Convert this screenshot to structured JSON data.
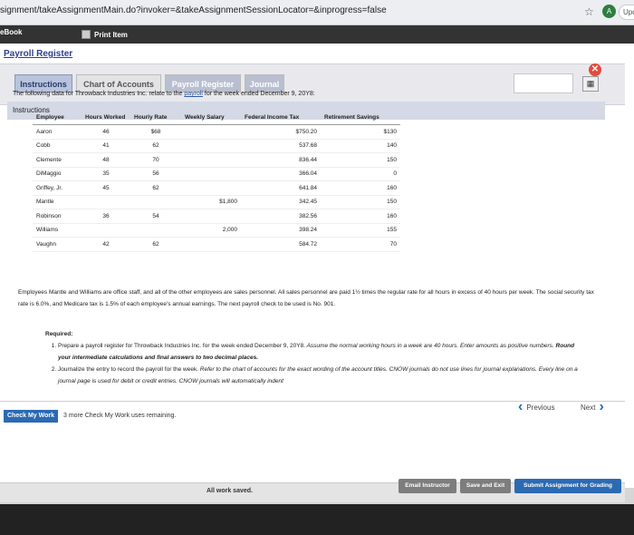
{
  "browser": {
    "url": "signment/takeAssignmentMain.do?invoker=&takeAssignmentSessionLocator=&inprogress=false",
    "star": "☆",
    "profile": "A",
    "update": "Update"
  },
  "toolbar": {
    "ebook": "eBook",
    "print": "Print Item"
  },
  "page_title": "Payroll Register",
  "tabs": [
    "Instructions",
    "Chart of Accounts",
    "Payroll Register",
    "Journal"
  ],
  "section_title": "Instructions",
  "close": "✕",
  "calculator_icon": "calculator-icon",
  "intro": {
    "before": "The following data for Throwback Industries Inc. relate to the ",
    "link": "payroll",
    "after": " for the week ended December 9, 20Y8:"
  },
  "table": {
    "headers": [
      "Employee",
      "Hours Worked",
      "Hourly Rate",
      "Weekly Salary",
      "Federal Income Tax",
      "Retirement Savings"
    ],
    "rows": [
      [
        "Aaron",
        "46",
        "$68",
        "",
        "$750.20",
        "$130"
      ],
      [
        "Cobb",
        "41",
        "62",
        "",
        "537.68",
        "140"
      ],
      [
        "Clemente",
        "48",
        "70",
        "",
        "836.44",
        "150"
      ],
      [
        "DiMaggio",
        "35",
        "56",
        "",
        "366.04",
        "0"
      ],
      [
        "Griffey, Jr.",
        "45",
        "62",
        "",
        "641.84",
        "160"
      ],
      [
        "Mantle",
        "",
        "",
        "$1,800",
        "342.45",
        "150"
      ],
      [
        "Robinson",
        "36",
        "54",
        "",
        "382.56",
        "160"
      ],
      [
        "Williams",
        "",
        "",
        "2,000",
        "398.24",
        "155"
      ],
      [
        "Vaughn",
        "42",
        "62",
        "",
        "584.72",
        "70"
      ]
    ]
  },
  "paragraph": "Employees Mantle and Williams are office staff, and all of the other employees are sales personnel. All sales personnel are paid 1½ times the regular rate for all hours in excess of 40 hours per week. The social security tax rate is 6.0%, and Medicare tax is 1.5% of each employee's annual earnings. The next payroll check to be used is No. 901.",
  "required": {
    "title": "Required:",
    "item1_plain": "Prepare a payroll register for Throwback Industries Inc. for the week ended December 9, 20Y8.",
    "item1_italic": " Assume the normal working hours in a week are 40 hours. Enter amounts as positive numbers. ",
    "item1_bold": "Round your intermediate calculations and final answers to two decimal places.",
    "item2_plain": "Journalize the entry to record the payroll for the week.",
    "item2_italic": " Refer to the chart of accounts for the exact wording of the account titles. CNOW journals do not use lines for journal explanations. Every line on a journal page is used for debit or credit entries. CNOW journals will automatically indent"
  },
  "footer": {
    "check": "Check My Work",
    "remaining": "3 more Check My Work uses remaining.",
    "previous": "Previous",
    "next": "Next",
    "saved": "All work saved.",
    "email": "Email Instructor",
    "save_exit": "Save and Exit",
    "submit": "Submit Assignment for Grading"
  }
}
